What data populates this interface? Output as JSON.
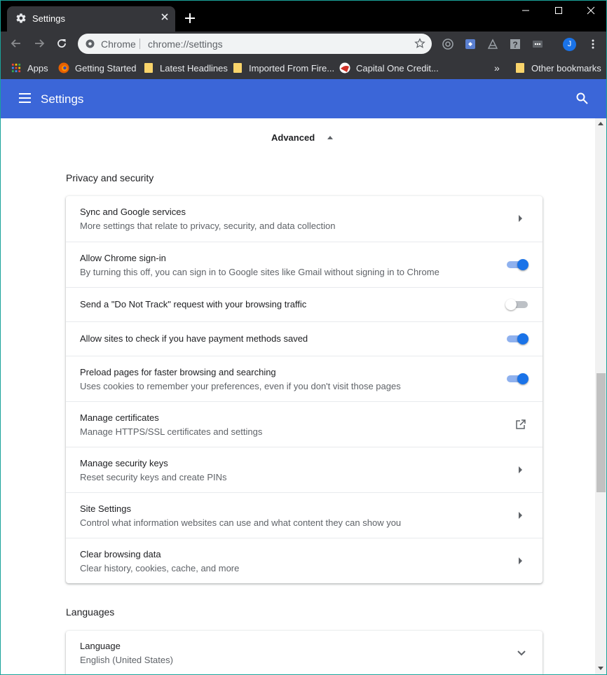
{
  "browser": {
    "tab_title": "Settings",
    "omnibox_site": "Chrome",
    "omnibox_url": "chrome://settings",
    "avatar_initial": "J"
  },
  "bookmarks": {
    "items": [
      {
        "label": "Apps",
        "icon": "apps-grid-icon"
      },
      {
        "label": "Getting Started",
        "icon": "firefox-icon"
      },
      {
        "label": "Latest Headlines",
        "icon": "folder-icon"
      },
      {
        "label": "Imported From Fire...",
        "icon": "folder-icon"
      },
      {
        "label": "Capital One Credit...",
        "icon": "capital-one-icon"
      }
    ],
    "overflow": "»",
    "other": "Other bookmarks"
  },
  "header": {
    "title": "Settings"
  },
  "advanced_label": "Advanced",
  "privacy": {
    "title": "Privacy and security",
    "rows": [
      {
        "label": "Sync and Google services",
        "sub": "More settings that relate to privacy, security, and data collection",
        "control": "chevron"
      },
      {
        "label": "Allow Chrome sign-in",
        "sub": "By turning this off, you can sign in to Google sites like Gmail without signing in to Chrome",
        "control": "toggle",
        "on": true
      },
      {
        "label": "Send a \"Do Not Track\" request with your browsing traffic",
        "control": "toggle",
        "on": false
      },
      {
        "label": "Allow sites to check if you have payment methods saved",
        "control": "toggle",
        "on": true
      },
      {
        "label": "Preload pages for faster browsing and searching",
        "sub": "Uses cookies to remember your preferences, even if you don't visit those pages",
        "control": "toggle",
        "on": true
      },
      {
        "label": "Manage certificates",
        "sub": "Manage HTTPS/SSL certificates and settings",
        "control": "external-link"
      },
      {
        "label": "Manage security keys",
        "sub": "Reset security keys and create PINs",
        "control": "chevron"
      },
      {
        "label": "Site Settings",
        "sub": "Control what information websites can use and what content they can show you",
        "control": "chevron"
      },
      {
        "label": "Clear browsing data",
        "sub": "Clear history, cookies, cache, and more",
        "control": "chevron"
      }
    ]
  },
  "languages": {
    "title": "Languages",
    "language_label": "Language",
    "language_value": "English (United States)"
  },
  "colors": {
    "header_blue": "#3b66d8",
    "toggle_on": "#1a73e8",
    "titlebar": "#000000",
    "toolbar": "#35363a"
  }
}
